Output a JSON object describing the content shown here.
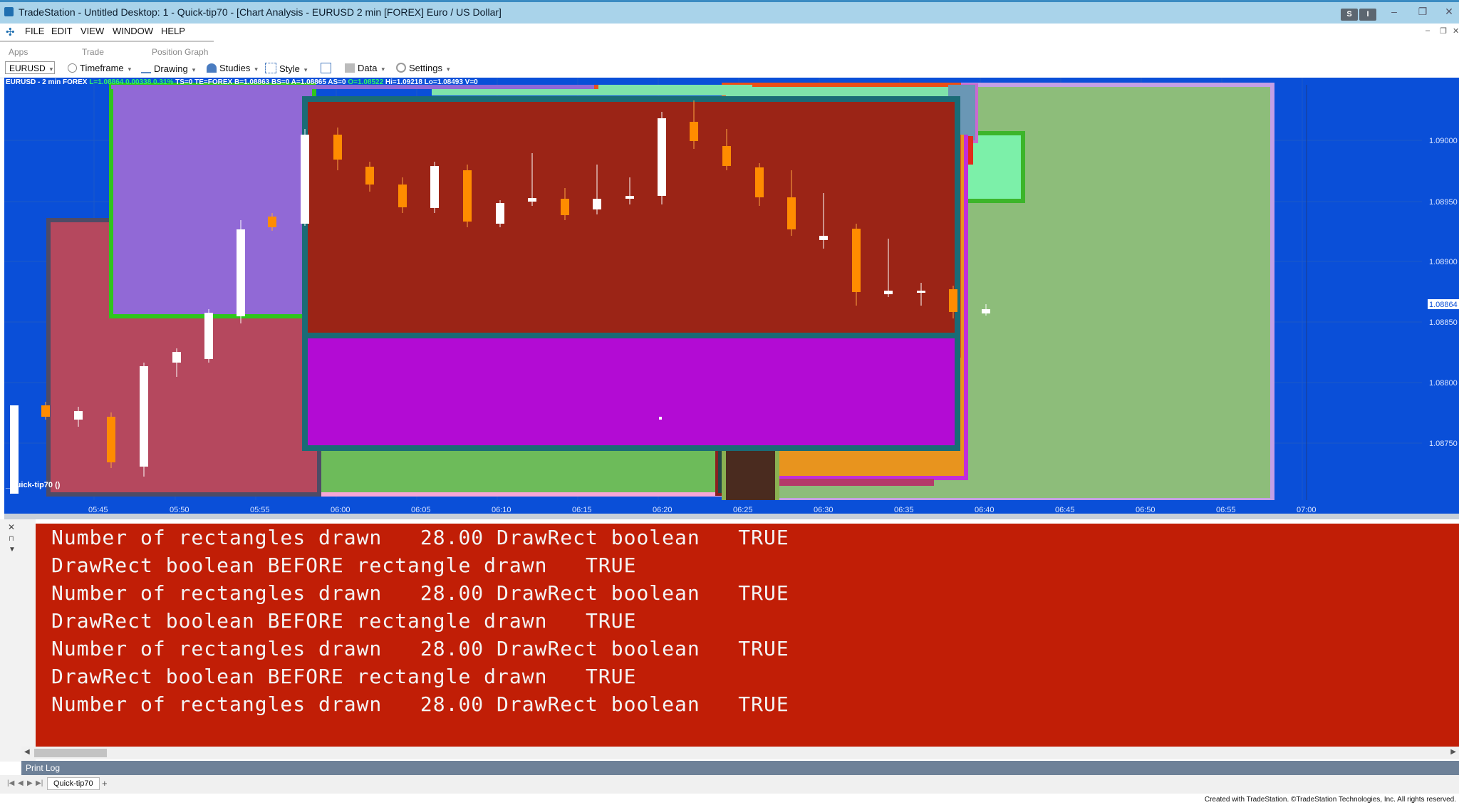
{
  "window": {
    "title": "TradeStation - Untitled Desktop: 1 - Quick-tip70 - [Chart Analysis - EURUSD 2 min [FOREX] Euro / US Dollar]",
    "badges": [
      "S",
      "I"
    ]
  },
  "menu": {
    "items": [
      "FILE",
      "EDIT",
      "VIEW",
      "WINDOW",
      "HELP"
    ]
  },
  "ribbon": {
    "tabs": [
      "Apps",
      "Trade",
      "Position Graph"
    ]
  },
  "toolbar": {
    "symbol": "EURUSD",
    "timeframe": "Timeframe",
    "drawing": "Drawing",
    "studies": "Studies",
    "style": "Style",
    "data": "Data",
    "settings": "Settings"
  },
  "chart": {
    "status_prefix": "EURUSD - 2 min  FOREX ",
    "status_values": "L=1.08864  0.00338  0.31%",
    "status_mid": "  TS=0  TE=FOREX  B=1.08863  BS=0  A=1.08865  AS=0  ",
    "status_open": "O=1.08522",
    "status_end": "  Hi=1.09218  Lo=1.08493  V=0",
    "study_label": "_Quick-tip70 ()",
    "price_labels": [
      "1.09000",
      "1.08950",
      "1.08900",
      "1.08864",
      "1.08850",
      "1.08800",
      "1.08750"
    ],
    "time_labels": [
      "05:45",
      "05:50",
      "05:55",
      "06:00",
      "06:05",
      "06:10",
      "06:15",
      "06:20",
      "06:25",
      "06:30",
      "06:35",
      "06:40",
      "06:45",
      "06:50",
      "06:55",
      "07:00"
    ],
    "colors": {
      "background": "#0a4fd8",
      "up_candle": "#ffffff",
      "down_candle": "#ff8c00"
    }
  },
  "print_log": {
    "lines": [
      "Number of rectangles drawn   28.00 DrawRect boolean   TRUE",
      "DrawRect boolean BEFORE rectangle drawn   TRUE",
      "Number of rectangles drawn   28.00 DrawRect boolean   TRUE",
      "DrawRect boolean BEFORE rectangle drawn   TRUE",
      "Number of rectangles drawn   28.00 DrawRect boolean   TRUE",
      "DrawRect boolean BEFORE rectangle drawn   TRUE",
      "Number of rectangles drawn   28.00 DrawRect boolean   TRUE"
    ],
    "bar_label": "Print Log"
  },
  "workspace": {
    "tab": "Quick-tip70",
    "add": "+"
  },
  "footer": "Created with TradeStation. ©TradeStation Technologies, Inc. All rights reserved."
}
